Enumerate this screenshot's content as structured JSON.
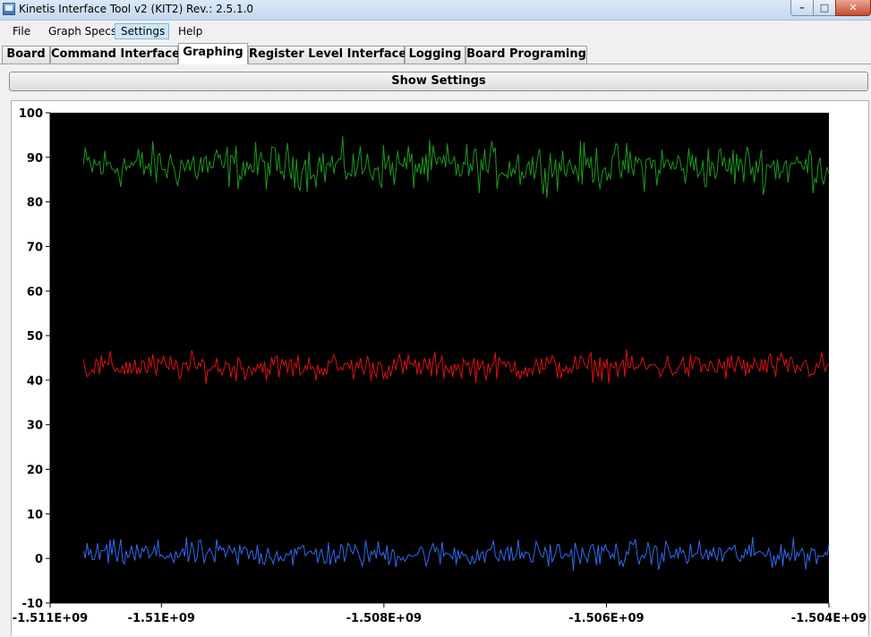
{
  "window": {
    "title": "Kinetis Interface Tool v2 (KIT2) Rev.: 2.5.1.0",
    "minimize_glyph": "–",
    "maximize_glyph": "□",
    "close_glyph": "✕"
  },
  "menu": {
    "items": [
      {
        "label": "File"
      },
      {
        "label": "Graph Specs"
      },
      {
        "label": "Settings",
        "active": true
      },
      {
        "label": "Help"
      }
    ]
  },
  "tabs": [
    {
      "label": "Board"
    },
    {
      "label": "Command Interface"
    },
    {
      "label": "Graphing",
      "selected": true
    },
    {
      "label": "Register Level Interface"
    },
    {
      "label": "Logging"
    },
    {
      "label": "Board Programing"
    }
  ],
  "graph": {
    "show_settings_label": "Show Settings"
  },
  "chart_data": {
    "type": "line",
    "background_color": "#000000",
    "grid": false,
    "title": "",
    "xlabel": "",
    "ylabel": "",
    "ylim": [
      -10,
      100
    ],
    "xlim": [
      -1511000000.0,
      -1504000000.0
    ],
    "y_ticks": [
      "-10",
      "0",
      "10",
      "20",
      "30",
      "40",
      "50",
      "60",
      "70",
      "80",
      "90",
      "100"
    ],
    "x_ticks": [
      {
        "value": -1511000000.0,
        "label": "-1.511E+09"
      },
      {
        "value": -1510000000.0,
        "label": "-1.51E+09"
      },
      {
        "value": -1508000000.0,
        "label": "-1.508E+09"
      },
      {
        "value": -1506000000.0,
        "label": "-1.506E+09"
      },
      {
        "value": -1504000000.0,
        "label": "-1.504E+09"
      }
    ],
    "x_range_of_data": [
      -1510700000.0,
      -1504000000.0
    ],
    "series": [
      {
        "color": "#1a9a1a",
        "mean": 88,
        "noise_amplitude": 2.5
      },
      {
        "color": "#e01010",
        "mean": 43,
        "noise_amplitude": 1.5
      },
      {
        "color": "#2e6cf0",
        "mean": 1,
        "noise_amplitude": 1.5
      }
    ]
  }
}
